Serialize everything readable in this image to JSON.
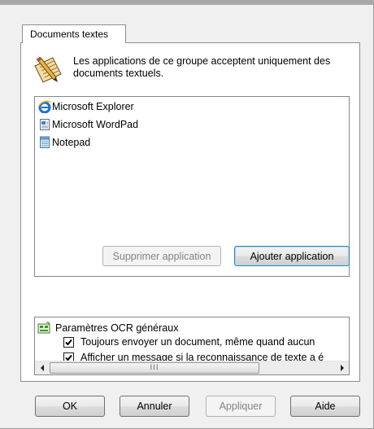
{
  "tab": {
    "label": "Documents textes"
  },
  "intro": {
    "text": "Les applications de ce groupe acceptent uniquement des documents textuels."
  },
  "applications": [
    {
      "label": "Microsoft Explorer",
      "icon": "internet-explorer-icon"
    },
    {
      "label": "Microsoft WordPad",
      "icon": "wordpad-icon"
    },
    {
      "label": "Notepad",
      "icon": "notepad-icon"
    }
  ],
  "app_buttons": {
    "remove_label": "Supprimer application",
    "add_label": "Ajouter application"
  },
  "ocr": {
    "root_label": "Paramètres OCR généraux",
    "options": [
      {
        "label": "Toujours envoyer un document, même quand aucun",
        "checked": true
      },
      {
        "label": "Afficher un message si la reconnaissance de texte a é",
        "checked": true
      }
    ],
    "scroll_grip": "III"
  },
  "footer": {
    "ok_label": "OK",
    "cancel_label": "Annuler",
    "apply_label": "Appliquer",
    "help_label": "Aide"
  },
  "colors": {
    "dialog_bg": "#f0f0f0",
    "panel_bg": "#ffffff",
    "focus_border": "#3c7fb1",
    "disabled_text": "#838383"
  }
}
